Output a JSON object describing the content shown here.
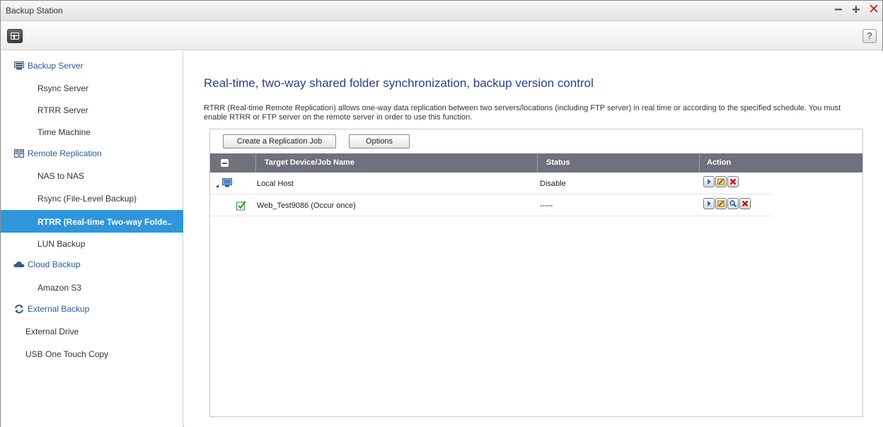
{
  "window": {
    "title": "Backup Station",
    "controls": {
      "minimize": "−",
      "maximize": "+",
      "close": "✕"
    }
  },
  "toolbar": {
    "help_label": "?"
  },
  "sidebar": {
    "groups": [
      {
        "label": "Backup Server",
        "icon": "server-icon",
        "items": [
          "Rsync Server",
          "RTRR Server",
          "Time Machine"
        ]
      },
      {
        "label": "Remote Replication",
        "icon": "replication-icon",
        "items": [
          "NAS to NAS",
          "Rsync (File-Level Backup)",
          "RTRR (Real-time Two-way Folde..",
          "LUN Backup"
        ]
      },
      {
        "label": "Cloud Backup",
        "icon": "cloud-icon",
        "items": [
          "Amazon S3"
        ]
      },
      {
        "label": "External Backup",
        "icon": "sync-arrows-icon",
        "items": [
          "External Drive",
          "USB One Touch Copy"
        ]
      }
    ],
    "active_item": "RTRR (Real-time Two-way Folde.."
  },
  "main": {
    "heading": "Real-time, two-way shared folder synchronization, backup version control",
    "description": "RTRR (Real-time Remote Replication) allows one-way data replication between two servers/locations (including FTP server) in real time or according to the specified schedule. You must enable RTRR or FTP server on the remote server in order to use this function.",
    "buttons": {
      "create": "Create a Replication Job",
      "options": "Options"
    },
    "columns": {
      "name": "Target Device/Job Name",
      "status": "Status",
      "action": "Action"
    },
    "rows": [
      {
        "name": "Local Host",
        "status": "Disable",
        "type": "host"
      },
      {
        "name": "Web_Test9086 (Occur once)",
        "status": "-----",
        "type": "job"
      }
    ]
  },
  "colors": {
    "accent": "#2f96dc",
    "heading": "#2d3d8f",
    "group_label": "#2a5c9a",
    "grid_header": "#6f727c",
    "close": "#d42020"
  }
}
